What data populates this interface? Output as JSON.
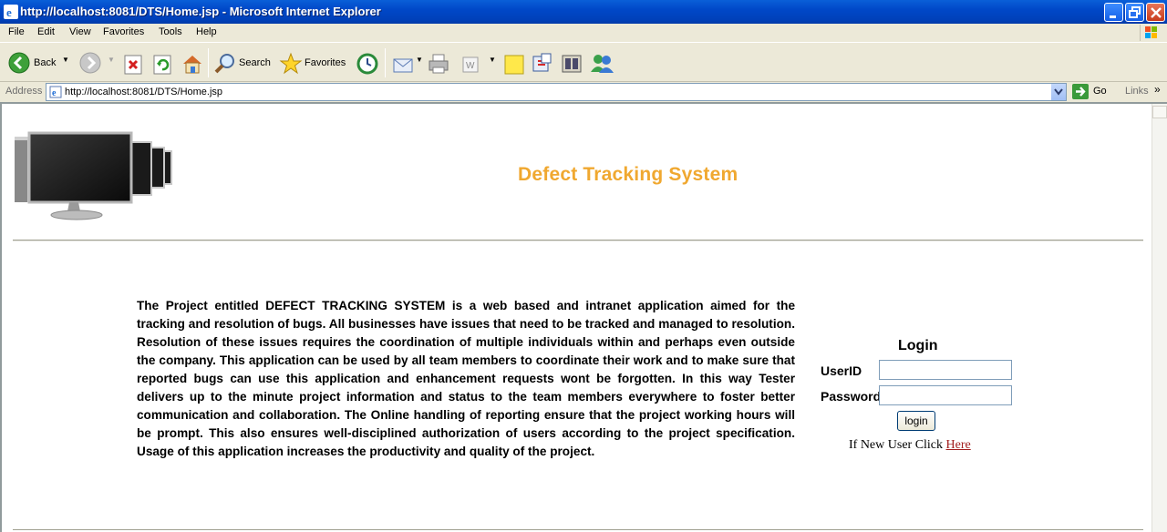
{
  "window": {
    "title": "http://localhost:8081/DTS/Home.jsp - Microsoft Internet Explorer"
  },
  "menu": {
    "items": [
      "File",
      "Edit",
      "View",
      "Favorites",
      "Tools",
      "Help"
    ]
  },
  "toolbar": {
    "back_label": "Back",
    "search_label": "Search",
    "favorites_label": "Favorites"
  },
  "address": {
    "label": "Address",
    "url": "http://localhost:8081/DTS/Home.jsp",
    "go_label": "Go",
    "links_label": "Links"
  },
  "page": {
    "title": "Defect Tracking System",
    "description": "The Project entitled DEFECT TRACKING SYSTEM is a web based and intranet application aimed for the tracking and resolution of bugs. All businesses have issues that need to be tracked and managed to resolution. Resolution of these issues requires the coordination of multiple individuals within and perhaps even outside the company. This application can be used by all team members to coordinate their work and to make sure that reported bugs can use this application and enhancement requests wont be forgotten. In this way Tester delivers up to the minute project information and status to the team members everywhere to foster better communication and collaboration. The Online handling of reporting ensure that the project working hours will be prompt. This also ensures well-disciplined authorization of users according to the project specification. Usage of this application increases the productivity and quality of the project.",
    "login": {
      "title": "Login",
      "userid_label": "UserID",
      "userid_value": "",
      "password_label": "Password",
      "password_value": "",
      "button_label": "login",
      "new_user_text": "If New User Click",
      "new_user_link": "Here"
    }
  },
  "colors": {
    "title": "#f0a830",
    "link": "#a21e1e",
    "titlebar": "#0048c8"
  }
}
